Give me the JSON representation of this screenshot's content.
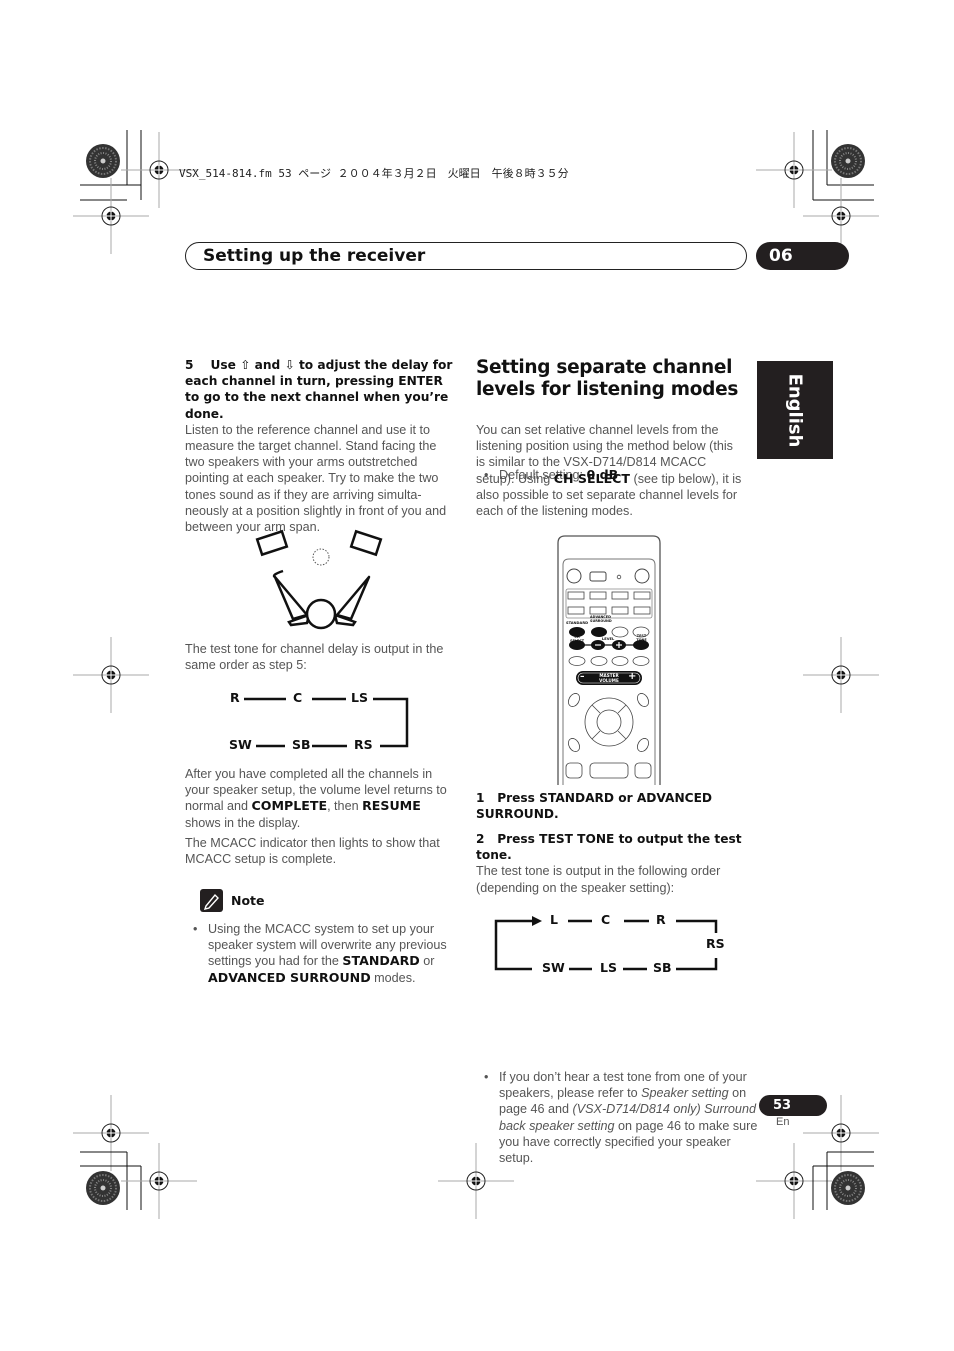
{
  "print_header": {
    "file_info": "VSX_514-814.fm  53 ページ  ２００４年３月２日　火曜日　午後８時３５分"
  },
  "section": {
    "title": "Setting up the receiver",
    "chapter_number": "06"
  },
  "language_tab": "English",
  "left_column": {
    "step5": {
      "number": "5",
      "heading_part1": "Use",
      "up_arrow": "⇧",
      "heading_and": "and",
      "down_arrow": "⇩",
      "heading_part2": "to adjust the delay for each channel in turn, pressing ENTER to go to the next channel when you’re done.",
      "body": "Listen to the reference channel and use it to measure the target channel. Stand facing the two speakers with your arms outstretched pointing at each speaker. Try to make the two tones sound as if they are arriving simulta-neously at a position slightly in front of you and between your arm span."
    },
    "delay_order_intro": "The test tone for channel delay is output in the same order as step 5:",
    "delay_flow": {
      "top": [
        "R",
        "C",
        "LS"
      ],
      "bottom": [
        "SW",
        "SB",
        "RS"
      ]
    },
    "completion": {
      "pre": "After you have completed all the channels in your speaker setup, the volume level returns to normal and ",
      "bold1": "COMPLETE",
      "mid": ", then ",
      "bold2": "RESUME",
      "post": " shows in the display."
    },
    "mcacc_text": "The MCACC indicator then lights to show that MCACC setup is complete.",
    "note": {
      "label": "Note",
      "pre": "Using the MCACC system to set up your speaker system will overwrite any previous settings you had for the ",
      "bold1": "STANDARD",
      "mid": " or ",
      "bold2": "ADVANCED SURROUND",
      "post": " modes."
    }
  },
  "right_column": {
    "heading": "Setting separate channel levels for listening modes",
    "default_label": "Default setting: ",
    "default_value": "0 dB",
    "intro": {
      "pre": "You can set relative channel levels from the listening position using the method below (this is similar to the VSX-D714/D814 MCACC setup). Using ",
      "bold": "CH SELECT",
      "post": " (see tip below), it is also possible to set separate channel levels for each of the listening modes."
    },
    "remote": {
      "labels": {
        "standard": "STANDARD",
        "advanced_surround": "ADVANCED SURROUND",
        "ch_select": "CH SELECT",
        "level": "LEVEL",
        "test_tone": "TEST TONE",
        "master_volume_line1": "MASTER",
        "master_volume_line2": "VOLUME",
        "minus": "–",
        "plus": "+"
      }
    },
    "step1": {
      "number": "1",
      "text": "Press STANDARD or ADVANCED SURROUND."
    },
    "step2": {
      "number": "2",
      "text": "Press TEST TONE to output the test tone.",
      "body": "The test tone is output in the following order (depending on the speaker setting):"
    },
    "level_flow": {
      "top": [
        "L",
        "C",
        "R"
      ],
      "right": "RS",
      "bottom": [
        "SW",
        "LS",
        "SB"
      ]
    },
    "tip": {
      "pre": "If you don’t hear a test tone from one of your speakers, please refer to ",
      "ital1": "Speaker setting",
      "mid": " on page 46 and ",
      "ital2": "(VSX-D714/D814 only) Surround back speaker setting",
      "post": " on page 46 to make sure you have correctly specified your speaker setup."
    }
  },
  "footer": {
    "page_number": "53",
    "language_code": "En"
  }
}
